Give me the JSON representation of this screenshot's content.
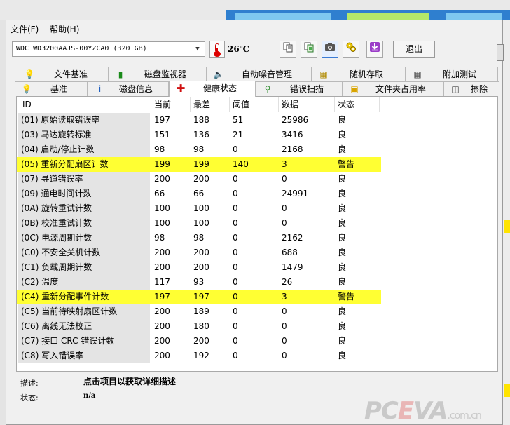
{
  "menu": {
    "file": "文件(F)",
    "help": "帮助(H)"
  },
  "toolbar": {
    "drive": "WDC WD3200AAJS-00YZCA0 (320 GB)",
    "temperature": "26℃",
    "exit_label": "退出"
  },
  "tabs_row1": [
    "文件基准",
    "磁盘监视器",
    "自动噪音管理",
    "随机存取",
    "附加测试"
  ],
  "tabs_row2": [
    "基准",
    "磁盘信息",
    "健康状态",
    "错误扫描",
    "文件夹占用率",
    "擦除"
  ],
  "active_tab": "健康状态",
  "table": {
    "headers": [
      "ID",
      "当前",
      "最差",
      "阈值",
      "数据",
      "状态"
    ],
    "rows": [
      {
        "id": "(01) 原始读取错误率",
        "current": "197",
        "worst": "188",
        "threshold": "51",
        "data": "25986",
        "status": "良",
        "warn": false
      },
      {
        "id": "(03) 马达旋转标准",
        "current": "151",
        "worst": "136",
        "threshold": "21",
        "data": "3416",
        "status": "良",
        "warn": false
      },
      {
        "id": "(04) 启动/停止计数",
        "current": "98",
        "worst": "98",
        "threshold": "0",
        "data": "2168",
        "status": "良",
        "warn": false
      },
      {
        "id": "(05) 重新分配扇区计数",
        "current": "199",
        "worst": "199",
        "threshold": "140",
        "data": "3",
        "status": "警告",
        "warn": true
      },
      {
        "id": "(07) 寻道错误率",
        "current": "200",
        "worst": "200",
        "threshold": "0",
        "data": "0",
        "status": "良",
        "warn": false
      },
      {
        "id": "(09) 通电时间计数",
        "current": "66",
        "worst": "66",
        "threshold": "0",
        "data": "24991",
        "status": "良",
        "warn": false
      },
      {
        "id": "(0A) 旋转重试计数",
        "current": "100",
        "worst": "100",
        "threshold": "0",
        "data": "0",
        "status": "良",
        "warn": false
      },
      {
        "id": "(0B) 校准重试计数",
        "current": "100",
        "worst": "100",
        "threshold": "0",
        "data": "0",
        "status": "良",
        "warn": false
      },
      {
        "id": "(0C) 电源周期计数",
        "current": "98",
        "worst": "98",
        "threshold": "0",
        "data": "2162",
        "status": "良",
        "warn": false
      },
      {
        "id": "(C0) 不安全关机计数",
        "current": "200",
        "worst": "200",
        "threshold": "0",
        "data": "688",
        "status": "良",
        "warn": false
      },
      {
        "id": "(C1) 负载周期计数",
        "current": "200",
        "worst": "200",
        "threshold": "0",
        "data": "1479",
        "status": "良",
        "warn": false
      },
      {
        "id": "(C2) 温度",
        "current": "117",
        "worst": "93",
        "threshold": "0",
        "data": "26",
        "status": "良",
        "warn": false
      },
      {
        "id": "(C4) 重新分配事件计数",
        "current": "197",
        "worst": "197",
        "threshold": "0",
        "data": "3",
        "status": "警告",
        "warn": true
      },
      {
        "id": "(C5) 当前待映射扇区计数",
        "current": "200",
        "worst": "189",
        "threshold": "0",
        "data": "0",
        "status": "良",
        "warn": false
      },
      {
        "id": "(C6) 离线无法校正",
        "current": "200",
        "worst": "180",
        "threshold": "0",
        "data": "0",
        "status": "良",
        "warn": false
      },
      {
        "id": "(C7) 接口 CRC 错误计数",
        "current": "200",
        "worst": "200",
        "threshold": "0",
        "data": "0",
        "status": "良",
        "warn": false
      },
      {
        "id": "(C8) 写入错误率",
        "current": "200",
        "worst": "192",
        "threshold": "0",
        "data": "0",
        "status": "良",
        "warn": false
      }
    ]
  },
  "description": {
    "desc_label": "描述:",
    "desc_value": "点击项目以获取详细描述",
    "status_label": "状态:",
    "status_value": "n/a"
  },
  "watermark": {
    "brand_a": "PC",
    "brand_e": "E",
    "brand_b": "VA",
    "suffix": ".com.cn"
  },
  "colors": {
    "warning_row": "#ffff33",
    "id_column_bg": "#e4e4e4",
    "accent_blue": "#2f7fcf"
  }
}
